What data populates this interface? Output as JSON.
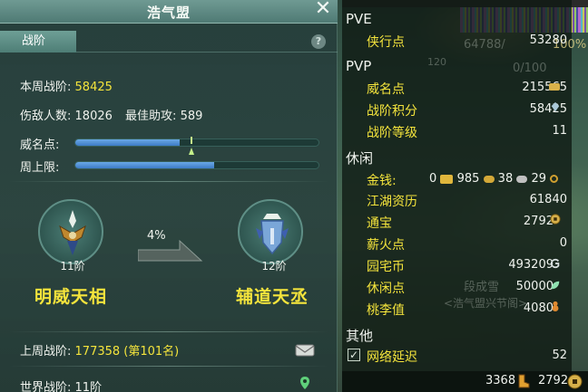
{
  "window": {
    "title": "浩气盟",
    "tab_active": "战阶"
  },
  "stats": {
    "weekly_rank_label": "本周战阶:",
    "weekly_rank_value": "58425",
    "kills_label": "伤敌人数:",
    "kills_value": "18026",
    "assists_label": "最佳助攻:",
    "assists_value": "589",
    "prestige_label": "威名点:",
    "prestige_fill": 0.43,
    "cap_label": "周上限:",
    "cap_fill": 0.57
  },
  "ranks": {
    "current_level": "11阶",
    "current_name": "明威天相",
    "next_level": "12阶",
    "next_name": "辅道天丞",
    "progress_text": "4%"
  },
  "footer": {
    "last_week_label": "上周战阶:",
    "last_week_value": "177358 (第101名)",
    "world_label": "世界战阶:",
    "world_value": "11阶"
  },
  "side": {
    "pve_title": "PVE",
    "pve_items": [
      {
        "label": "侠行点",
        "value": "53280"
      }
    ],
    "pvp_title": "PVP",
    "pvp_items": [
      {
        "label": "威名点",
        "value": "215565"
      },
      {
        "label": "战阶积分",
        "value": "58425"
      },
      {
        "label": "战阶等级",
        "value": "11"
      }
    ],
    "leisure_title": "休闲",
    "money_label": "金钱:",
    "money_gold": "0",
    "money_silver": "985",
    "money_copper1": "38",
    "money_copper2": "29",
    "leisure_items": [
      {
        "label": "江湖资历",
        "value": "61840"
      },
      {
        "label": "通宝",
        "value": "2792"
      },
      {
        "label": "薪火点",
        "value": "0"
      },
      {
        "label": "园宅币",
        "value": "493209"
      },
      {
        "label": "休闲点",
        "value": "50000"
      },
      {
        "label": "桃李值",
        "value": "4080"
      }
    ],
    "other_title": "其他",
    "latency_label": "网络延迟",
    "latency_value": "52",
    "bottom_left": "3368",
    "bottom_right": "2792"
  },
  "background_texts": {
    "hp": "64788/",
    "pct": "100%",
    "level": "120",
    "bar": "0/100",
    "npc_name": "段成雪",
    "npc_title": "<浩气盟兴节阁>"
  },
  "colors": {
    "accent_yellow": "#f4e43c",
    "bar_blue": "#3d7bc6",
    "panel_teal": "#2a423e"
  }
}
